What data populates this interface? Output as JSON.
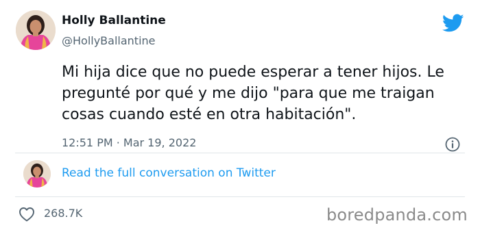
{
  "author": {
    "display_name": "Holly Ballantine",
    "handle": "@HollyBallantine"
  },
  "tweet": {
    "text": "Mi hija dice que no puede esperar a tener hijos. Le\npregunté por qué y me dijo \"para que me traigan\ncosas cuando esté en otra habitación\".",
    "timestamp": "12:51 PM · Mar 19, 2022"
  },
  "conversation_link": "Read the full conversation on Twitter",
  "likes": {
    "count": "268.7K"
  },
  "watermark": "boredpanda.com",
  "icons": {
    "brand": "twitter-bird-icon",
    "info": "info-icon",
    "like": "heart-icon"
  },
  "colors": {
    "brand_blue": "#1d9bf0",
    "secondary_text": "#536471",
    "primary_text": "#0f1419",
    "divider": "#dfe5e9",
    "watermark": "#8a8a8a"
  }
}
